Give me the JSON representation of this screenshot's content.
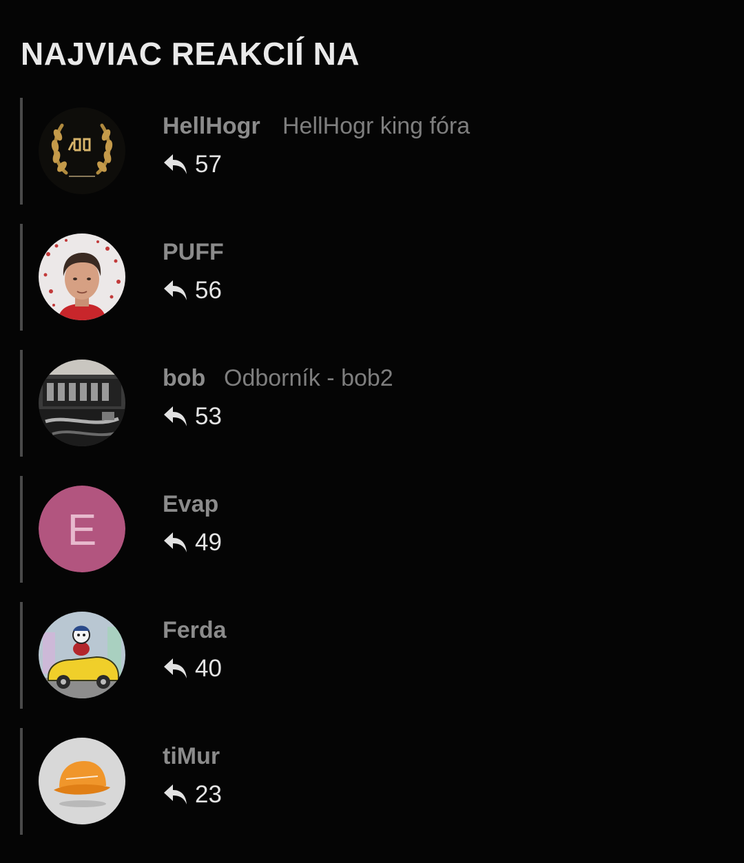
{
  "header": {
    "title": "NAJVIAC REAKCIÍ NA"
  },
  "colors": {
    "background": "#050505",
    "name": "#8b8b8b",
    "count": "#e4e4e4",
    "divider": "#4a4a4a",
    "avatar_evap": "#b2557f"
  },
  "users": [
    {
      "name": "HellHogr",
      "title": "HellHogr king fóra",
      "replies": "57",
      "avatar": "laurel-400-avatar"
    },
    {
      "name": "PUFF",
      "title": "",
      "replies": "56",
      "avatar": "driver-portrait-avatar"
    },
    {
      "name": "bob",
      "title": "Odborník - bob2",
      "replies": "53",
      "avatar": "engine-photo-avatar"
    },
    {
      "name": "Evap",
      "title": "",
      "replies": "49",
      "avatar": "letter-avatar",
      "initial": "E"
    },
    {
      "name": "Ferda",
      "title": "",
      "replies": "40",
      "avatar": "cartoon-car-avatar"
    },
    {
      "name": "tiMur",
      "title": "",
      "replies": "23",
      "avatar": "orange-cap-avatar"
    }
  ],
  "icons": {
    "reply": "reply-arrow-icon"
  }
}
